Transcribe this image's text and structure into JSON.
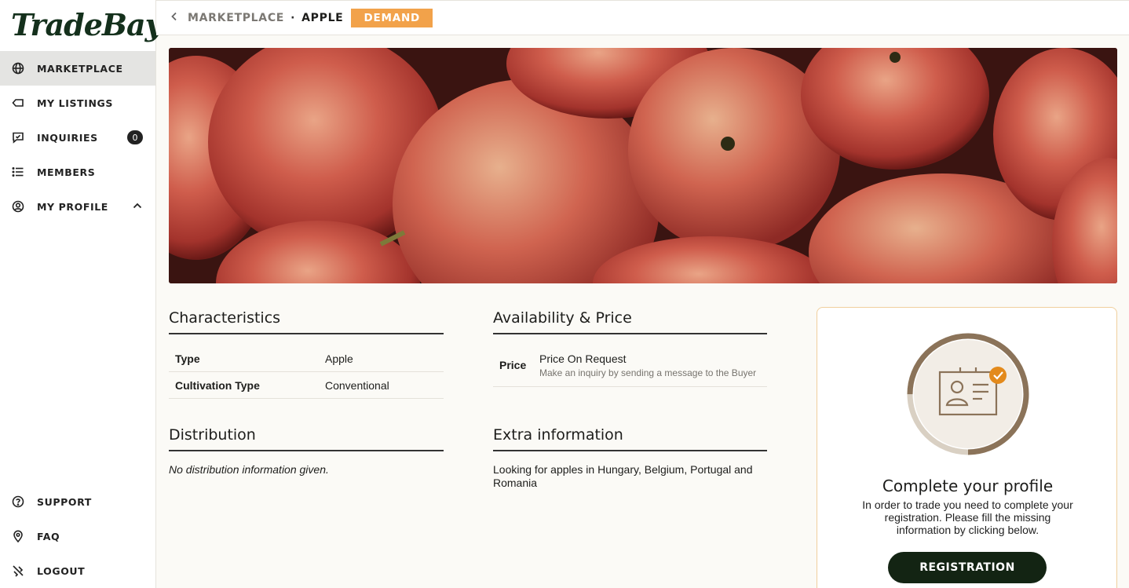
{
  "app": {
    "logo_text": "TradeBay"
  },
  "sidebar": {
    "items": [
      {
        "label": "MARKETPLACE",
        "icon": "globe-icon",
        "active": true
      },
      {
        "label": "MY LISTINGS",
        "icon": "tag-icon"
      },
      {
        "label": "INQUIRIES",
        "icon": "message-icon",
        "badge": "0"
      },
      {
        "label": "MEMBERS",
        "icon": "list-icon"
      },
      {
        "label": "MY PROFILE",
        "icon": "user-circle-icon",
        "expand_icon": "chevron-up-icon"
      }
    ],
    "bottom_items": [
      {
        "label": "SUPPORT",
        "icon": "help-circle-icon"
      },
      {
        "label": "FAQ",
        "icon": "location-pin-icon"
      },
      {
        "label": "LOGOUT",
        "icon": "logout-icon"
      }
    ]
  },
  "breadcrumb": {
    "back_icon": "chevron-left-icon",
    "parent": "MARKETPLACE",
    "separator": "·",
    "current": "APPLE",
    "tag": "DEMAND",
    "tag_color": "#f2a24a"
  },
  "hero": {
    "image": "red-apples-photo"
  },
  "characteristics": {
    "title": "Characteristics",
    "rows": [
      {
        "key": "Type",
        "value": "Apple"
      },
      {
        "key": "Cultivation Type",
        "value": "Conventional"
      }
    ]
  },
  "availability": {
    "title": "Availability & Price",
    "price_label": "Price",
    "price_value": "Price On Request",
    "price_note": "Make an inquiry by sending a message to the Buyer"
  },
  "distribution": {
    "title": "Distribution",
    "text": "No distribution information given."
  },
  "extra": {
    "title": "Extra information",
    "text": "Looking for apples in Hungary, Belgium, Portugal and Romania"
  },
  "profile_card": {
    "icon": "id-card-icon",
    "check_icon": "check-badge-icon",
    "title": "Complete your profile",
    "text": "In order to trade you need to complete your registration. Please fill the missing information by clicking below.",
    "button_label": "REGISTRATION",
    "progress_fraction": 0.75,
    "accent_color": "#e38a1c",
    "ring_color": "#8b7359"
  }
}
